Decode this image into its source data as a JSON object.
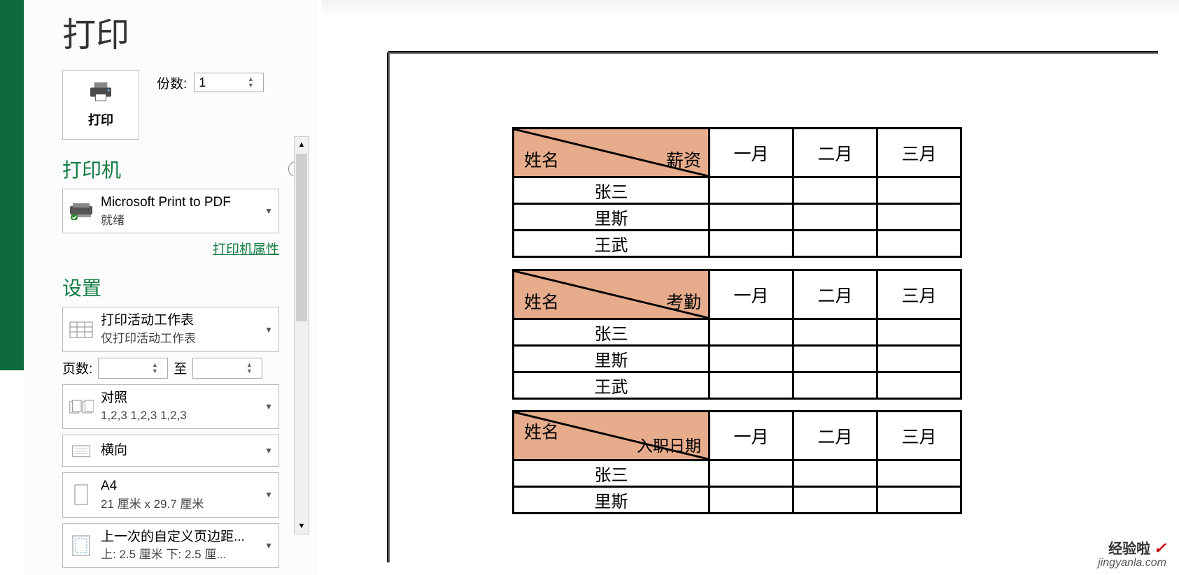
{
  "page_title": "打印",
  "print_button_label": "打印",
  "copies_label": "份数:",
  "copies_value": "1",
  "printer_section": "打印机",
  "printer_name": "Microsoft Print to PDF",
  "printer_status": "就绪",
  "printer_props": "打印机属性",
  "settings_section": "设置",
  "scope_title": "打印活动工作表",
  "scope_sub": "仅打印活动工作表",
  "pages_label": "页数:",
  "pages_to": "至",
  "collate_title": "对照",
  "collate_sub": "1,2,3    1,2,3    1,2,3",
  "orientation": "横向",
  "paper_size": "A4",
  "paper_dims": "21 厘米 x 29.7 厘米",
  "margins_title": "上一次的自定义页边距...",
  "margins_sub": "上: 2.5 厘米 下: 2.5 厘...",
  "months": [
    "一月",
    "二月",
    "三月"
  ],
  "header_left": "姓名",
  "tables": [
    {
      "right": "薪资",
      "rows": [
        "张三",
        "里斯",
        "王武"
      ]
    },
    {
      "right": "考勤",
      "rows": [
        "张三",
        "里斯",
        "王武"
      ]
    },
    {
      "right": "入职日期",
      "rows": [
        "张三",
        "里斯"
      ]
    }
  ],
  "watermark_top": "经验啦",
  "watermark_check": "✓",
  "watermark_bottom": "jingyanla.com"
}
